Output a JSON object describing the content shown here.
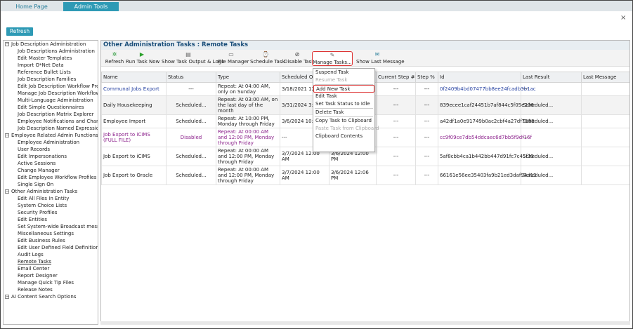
{
  "tabs": [
    "Home Page",
    "Admin Tools"
  ],
  "refresh_label": "Refresh",
  "close_glyph": "×",
  "tree": [
    {
      "label": "Job Description Administration",
      "items": [
        "Job Descriptions Administration",
        "Edit Master Templates",
        "Import O*Net Data",
        "Reference Bullet Lists",
        "Job Description Families",
        "Edit Job Description Workflow Profiles",
        "Manage Job Description Workflows",
        "Multi-Language Administration",
        "Edit Simple Questionnaires",
        "Job Description Matrix Explorer",
        "Employee Notifications and Change",
        "Job Description Named Expressions"
      ]
    },
    {
      "label": "Employee Related Admin Functions",
      "items": [
        "Employee Administration",
        "User Records",
        "Edit Impersonations",
        "Active Sessions",
        "Change Manager",
        "Edit Employee Workflow Profiles",
        "Single Sign On"
      ]
    },
    {
      "label": "Other Administration Tasks",
      "items": [
        "Edit All Files In Entity",
        "System Choice Lists",
        "Security Profiles",
        "Edit Entities",
        "Set System-wide Broadcast message",
        "Miscellaneous Settings",
        "Edit Business Rules",
        "Edit User Defined Field Definitions",
        "Audit Logs",
        "Remote Tasks",
        "Email Center",
        "Report Designer",
        "Manage Quick Tip Files",
        "Release Notes"
      ]
    },
    {
      "label": "AI Content Search Options",
      "items": []
    }
  ],
  "main_title": "Other Administration Tasks : Remote Tasks",
  "toolbar": [
    {
      "label": "Refresh",
      "icon": "refresh-icon",
      "glyph": "✲",
      "color": "#2a9a3a"
    },
    {
      "label": "Run Task Now",
      "icon": "play-icon",
      "glyph": "▶",
      "color": "#2aa02a"
    },
    {
      "label": "Show Task Output & Logs",
      "icon": "log-icon",
      "glyph": "▤",
      "color": "#666"
    },
    {
      "label": "File Manager",
      "icon": "file-manager-icon",
      "glyph": "▭",
      "color": "#666"
    },
    {
      "label": "Schedule Task",
      "icon": "schedule-icon",
      "glyph": "⌚",
      "color": "#2a9a3a"
    },
    {
      "label": "Disable Task",
      "icon": "disable-icon",
      "glyph": "⊘",
      "color": "#333"
    },
    {
      "label": "Manage Tasks...",
      "icon": "manage-icon",
      "glyph": "✎",
      "color": "#666"
    },
    {
      "label": "Show Last Message",
      "icon": "message-icon",
      "glyph": "✉",
      "color": "#2a7f9b"
    }
  ],
  "columns": [
    "Name",
    "Status",
    "Type",
    "Scheduled On",
    "",
    "Current Step #",
    "Step %",
    "Id",
    "Last Result",
    "Last Message"
  ],
  "rows": [
    {
      "name": "Communal Jobs Export",
      "status": "---",
      "type": "Repeat: At 04:00 AM, only on Sunday",
      "scheduled": "3/18/2021 12:5",
      "last_run": "",
      "step": "---",
      "pct": "---",
      "id": "0f2409b4bd07477bb8ee24fcadb3b1ac",
      "result": "---",
      "message": "",
      "cls": "blue"
    },
    {
      "name": "Daily Housekeeping",
      "status": "Scheduled...",
      "type": "Repeat: At 03:00 AM, on the last day of the month",
      "scheduled": "3/31/2024 3:00",
      "last_run": "",
      "step": "---",
      "pct": "---",
      "id": "839ecee1caf24451b7af844c5f05e206",
      "result": "Scheduled...",
      "message": "",
      "cls": ""
    },
    {
      "name": "Employee Import",
      "status": "Scheduled...",
      "type": "Repeat: At 10:00 PM, Monday through Friday",
      "scheduled": "3/6/2024 10:00",
      "last_run": "",
      "step": "---",
      "pct": "---",
      "id": "a42df1a0e91749b0ac2cbf4a27df7588",
      "result": "Scheduled...",
      "message": "",
      "cls": ""
    },
    {
      "name": "Job Export to iCIMS (FULL FILE)",
      "status": "Disabled",
      "type": "Repeat: At 00:00 AM and 12:00 PM, Monday through Friday",
      "scheduled": "---",
      "last_run": "",
      "step": "---",
      "pct": "---",
      "id": "cc9f09ce7db54ddcaec6d7bb5f9df16f",
      "result": "---",
      "message": "",
      "cls": "purple"
    },
    {
      "name": "Job Export to iCIMS",
      "status": "Scheduled...",
      "type": "Repeat: At 00:00 AM and 12:00 PM, Monday through Friday",
      "scheduled": "3/7/2024 12:00 AM",
      "last_run": "3/6/2024 12:00 PM",
      "step": "---",
      "pct": "---",
      "id": "5af8cbb4ca1b442bb447d91fc7c45f39",
      "result": "Scheduled...",
      "message": "",
      "cls": ""
    },
    {
      "name": "Job Export to Oracle",
      "status": "Scheduled...",
      "type": "Repeat: At 00:00 AM and 12:00 PM, Monday through Friday",
      "scheduled": "3/7/2024 12:00 AM",
      "last_run": "3/6/2024 12:06 PM",
      "step": "---",
      "pct": "---",
      "id": "66161e56ee35403fa9b21ed3daf94a13",
      "result": "Scheduled...",
      "message": "",
      "cls": ""
    }
  ],
  "menu": [
    {
      "label": "Suspend Task",
      "disabled": false
    },
    {
      "label": "Resume Task",
      "disabled": true
    },
    {
      "sep": true
    },
    {
      "label": "Add New Task",
      "disabled": false,
      "highlight": true
    },
    {
      "label": "Edit Task",
      "disabled": false
    },
    {
      "label": "Set Task Status to Idle",
      "disabled": false
    },
    {
      "sep": true
    },
    {
      "label": "Delete Task",
      "disabled": false
    },
    {
      "sep": true
    },
    {
      "label": "Copy Task to Clipboard",
      "disabled": false
    },
    {
      "label": "Paste Task from Clipboard",
      "disabled": true
    },
    {
      "label": "Clipboard Contents",
      "disabled": false
    }
  ]
}
